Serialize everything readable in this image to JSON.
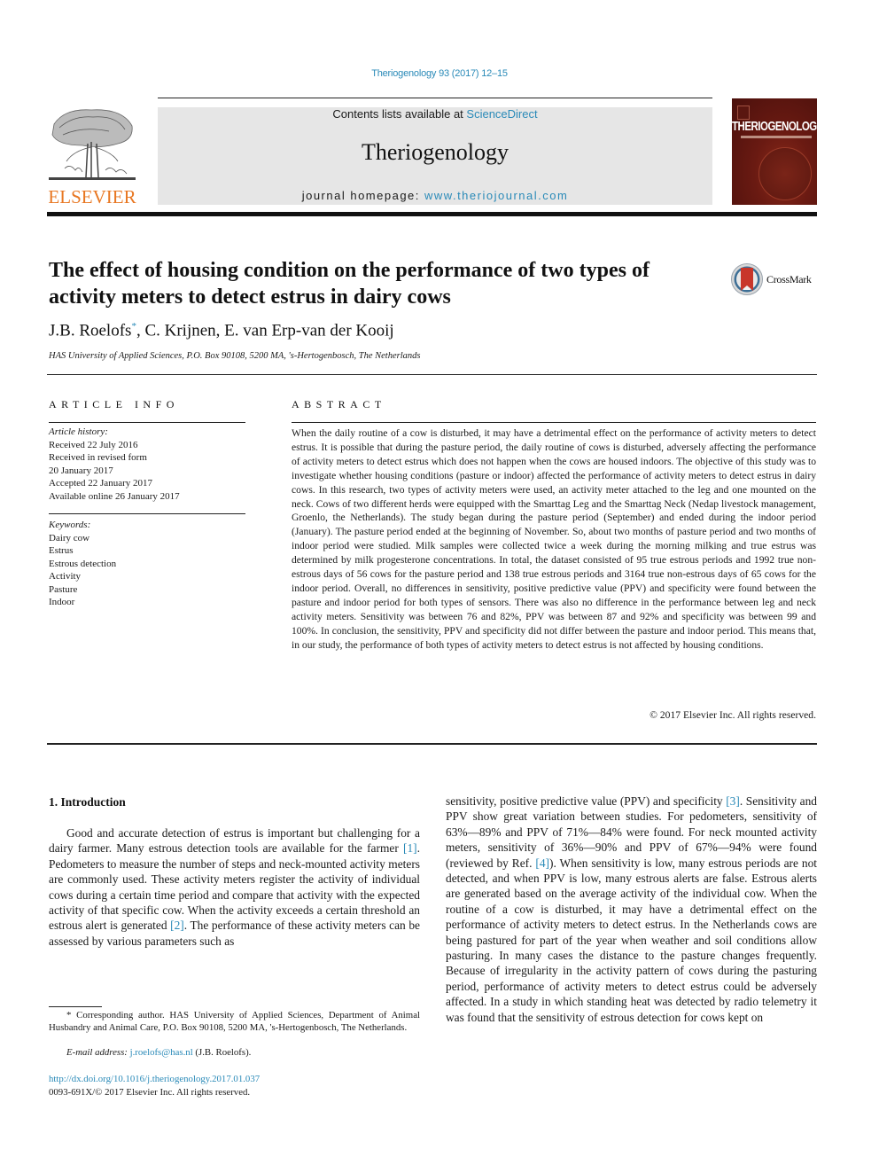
{
  "header": {
    "citation": "Theriogenology 93 (2017) 12–15",
    "publisher_logo_text": "ELSEVIER",
    "contents_prefix": "Contents lists available at ",
    "contents_link": "ScienceDirect",
    "journal_name": "Theriogenology",
    "homepage_prefix": "journal homepage: ",
    "homepage_link": "www.theriojournal.com",
    "cover_title": "THERIOGENOLOGY",
    "crossmark_label": "CrossMark"
  },
  "article": {
    "title": "The effect of housing condition on the performance of two types of activity meters to detect estrus in dairy cows",
    "authors": [
      {
        "name": "J.B. Roelofs",
        "marker": "*"
      },
      {
        "name": ", C. Krijnen, E. van Erp-van der Kooij",
        "marker": ""
      }
    ],
    "affiliation": "HAS University of Applied Sciences, P.O. Box 90108, 5200 MA, 's-Hertogenbosch, The Netherlands"
  },
  "article_info": {
    "heading": "ARTICLE INFO",
    "history_label": "Article history:",
    "history": [
      "Received 22 July 2016",
      "Received in revised form",
      "20 January 2017",
      "Accepted 22 January 2017",
      "Available online 26 January 2017"
    ],
    "keywords_label": "Keywords:",
    "keywords": [
      "Dairy cow",
      "Estrus",
      "Estrous detection",
      "Activity",
      "Pasture",
      "Indoor"
    ]
  },
  "abstract": {
    "heading": "ABSTRACT",
    "text": "When the daily routine of a cow is disturbed, it may have a detrimental effect on the performance of activity meters to detect estrus. It is possible that during the pasture period, the daily routine of cows is disturbed, adversely affecting the performance of activity meters to detect estrus which does not happen when the cows are housed indoors. The objective of this study was to investigate whether housing conditions (pasture or indoor) affected the performance of activity meters to detect estrus in dairy cows. In this research, two types of activity meters were used, an activity meter attached to the leg and one mounted on the neck. Cows of two different herds were equipped with the Smarttag Leg and the Smarttag Neck (Nedap livestock management, Groenlo, the Netherlands). The study began during the pasture period (September) and ended during the indoor period (January). The pasture period ended at the beginning of November. So, about two months of pasture period and two months of indoor period were studied. Milk samples were collected twice a week during the morning milking and true estrus was determined by milk progesterone concentrations. In total, the dataset consisted of 95 true estrous periods and 1992 true non-estrous days of 56 cows for the pasture period and 138 true estrous periods and 3164 true non-estrous days of 65 cows for the indoor period. Overall, no differences in sensitivity, positive predictive value (PPV) and specificity were found between the pasture and indoor period for both types of sensors. There was also no difference in the performance between leg and neck activity meters. Sensitivity was between 76 and 82%, PPV was between 87 and 92% and specificity was between 99 and 100%. In conclusion, the sensitivity, PPV and specificity did not differ between the pasture and indoor period. This means that, in our study, the performance of both types of activity meters to detect estrus is not affected by housing conditions.",
    "copyright": "© 2017 Elsevier Inc. All rights reserved."
  },
  "introduction": {
    "heading": "1.  Introduction",
    "left_segments": [
      {
        "text": "Good and accurate detection of estrus is important but challenging for a dairy farmer. Many estrous detection tools are available for the farmer ",
        "ref": false
      },
      {
        "text": "[1]",
        "ref": true
      },
      {
        "text": ". Pedometers to measure the number of steps and neck-mounted activity meters are commonly used. These activity meters register the activity of individual cows during a certain time period and compare that activity with the expected activity of that specific cow. When the activity exceeds a certain threshold an estrous alert is generated ",
        "ref": false
      },
      {
        "text": "[2]",
        "ref": true
      },
      {
        "text": ". The performance of these activity meters can be assessed by various parameters such as",
        "ref": false
      }
    ],
    "right_segments": [
      {
        "text": "sensitivity, positive predictive value (PPV) and specificity ",
        "ref": false
      },
      {
        "text": "[3]",
        "ref": true
      },
      {
        "text": ". Sensitivity and PPV show great variation between studies. For pedometers, sensitivity of 63%—89% and PPV of 71%—84% were found. For neck mounted activity meters, sensitivity of 36%—90% and PPV of 67%—94% were found (reviewed by Ref. ",
        "ref": false
      },
      {
        "text": "[4]",
        "ref": true
      },
      {
        "text": "). When sensitivity is low, many estrous periods are not detected, and when PPV is low, many estrous alerts are false. Estrous alerts are generated based on the average activity of the individual cow. When the routine of a cow is disturbed, it may have a detrimental effect on the performance of activity meters to detect estrus. In the Netherlands cows are being pastured for part of the year when weather and soil conditions allow pasturing. In many cases the distance to the pasture changes frequently. Because of irregularity in the activity pattern of cows during the pasturing period, performance of activity meters to detect estrus could be adversely affected. In a study in which standing heat was detected by radio telemetry it was found that the sensitivity of estrous detection for cows kept on",
        "ref": false
      }
    ]
  },
  "footnote": {
    "corresponding": "* Corresponding author. HAS University of Applied Sciences, Department of Animal Husbandry and Animal Care, P.O. Box 90108, 5200 MA, 's-Hertogenbosch, The Netherlands.",
    "email_label": "E-mail address: ",
    "email": "j.roelofs@has.nl",
    "email_suffix": " (J.B. Roelofs).",
    "doi": "http://dx.doi.org/10.1016/j.theriogenology.2017.01.037",
    "issn": "0093-691X/© 2017 Elsevier Inc. All rights reserved."
  }
}
